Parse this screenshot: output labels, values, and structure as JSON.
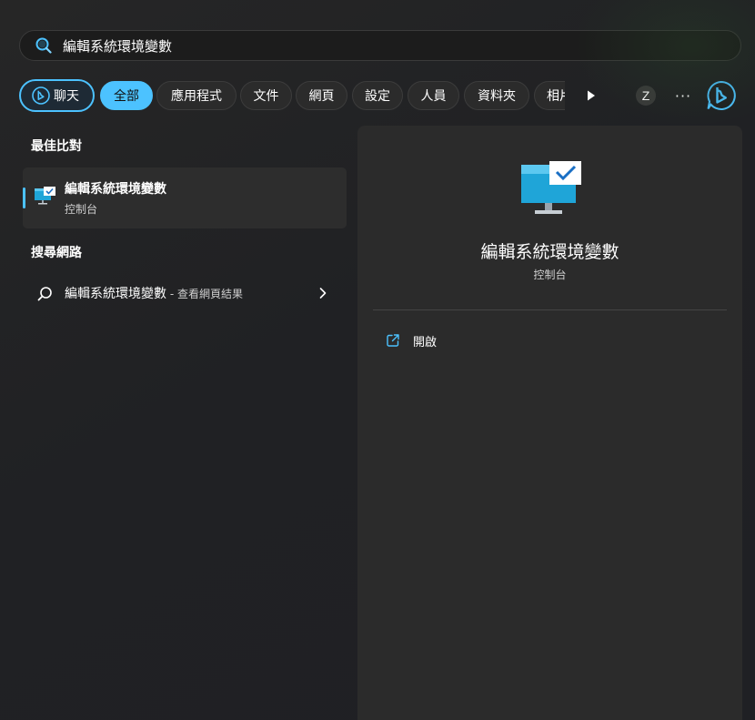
{
  "search": {
    "value": "編輯系統環境變數",
    "icon": "search-icon"
  },
  "filters": {
    "chat_label": "聊天",
    "all_label": "全部",
    "apps_label": "應用程式",
    "documents_label": "文件",
    "web_label": "網頁",
    "settings_label": "設定",
    "people_label": "人員",
    "folders_label": "資料夾",
    "photos_label": "相片",
    "avatar_initial": "Z",
    "more_label": "···"
  },
  "best_match": {
    "section_title": "最佳比對",
    "title": "編輯系統環境變數",
    "subtitle": "控制台",
    "icon": "control-panel-monitor-icon"
  },
  "web_search": {
    "section_title": "搜尋網路",
    "query": "編輯系統環境變數",
    "suffix": " - 查看網頁結果"
  },
  "preview": {
    "title": "編輯系統環境變數",
    "subtitle": "控制台",
    "open_label": "開啟"
  },
  "colors": {
    "accent": "#4cc2ff",
    "background": "#202020",
    "panel": "#2b2b2b",
    "selected_item": "#2d2d2d"
  }
}
